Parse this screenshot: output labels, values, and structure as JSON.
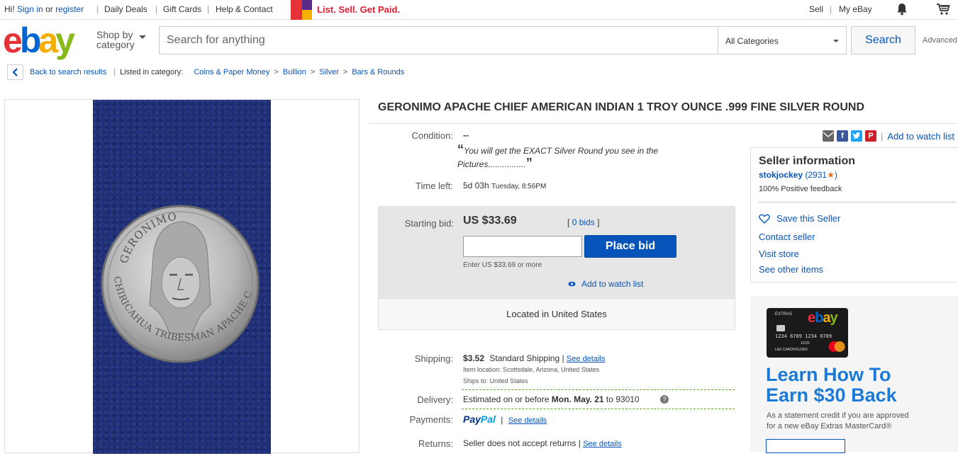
{
  "topbar": {
    "hi": "Hi!",
    "sign_in": "Sign in",
    "or": "or",
    "register": "register",
    "daily_deals": "Daily Deals",
    "gift_cards": "Gift Cards",
    "help": "Help & Contact",
    "promo": "List. Sell. Get Paid.",
    "sell": "Sell",
    "my_ebay": "My eBay"
  },
  "header": {
    "logo": [
      "e",
      "b",
      "a",
      "y"
    ],
    "shop_by": "Shop by",
    "category": "category",
    "search_placeholder": "Search for anything",
    "category_select": "All Categories",
    "search_button": "Search",
    "advanced": "Advanced"
  },
  "breadcrumb": {
    "back": "Back to search results",
    "listed_in": "Listed in category:",
    "items": [
      "Coins & Paper Money",
      "Bullion",
      "Silver",
      "Bars & Rounds"
    ]
  },
  "coin": {
    "top_text": "GERONIMO",
    "bottom_text": "CHIRICAHUA TRIBESMAN APACHE CHIEF"
  },
  "item": {
    "title": "GERONIMO APACHE CHIEF AMERICAN INDIAN 1 TROY OUNCE .999 FINE SILVER ROUND",
    "condition_label": "Condition:",
    "condition_value": "--",
    "quote_line1": "You will get the EXACT Silver Round you see in the",
    "quote_line2": "Pictures................",
    "time_left_label": "Time left:",
    "time_left": "5d 03h",
    "time_left_when": "Tuesday, 8:56PM",
    "share": {
      "watch": "Add to watch list"
    }
  },
  "bid": {
    "label": "Starting bid:",
    "price": "US $33.69",
    "bids_open": "[",
    "bids": "0 bids",
    "bids_close": "]",
    "place_bid": "Place bid",
    "hint": "Enter US $33.69 or more",
    "watch": "Add to watch list",
    "located": "Located in United States"
  },
  "shipping": {
    "label": "Shipping:",
    "price": "$3.52",
    "method": "Standard Shipping |",
    "see_details": "See details",
    "location": "Item location:  Scottsdale, Arizona, United States",
    "ships_to": "Ships to:  United States"
  },
  "delivery": {
    "label": "Delivery:",
    "prefix": "Estimated on or before",
    "date": "Mon. May. 21",
    "to": "to 93010"
  },
  "payments": {
    "label": "Payments:",
    "pay": "Pay",
    "pal": "Pal",
    "sep": "|",
    "see_details": "See details"
  },
  "returns": {
    "label": "Returns:",
    "text": "Seller does not accept returns |",
    "see_details": "See details"
  },
  "seller": {
    "heading": "Seller information",
    "name": "stokjockey",
    "score": "(2931",
    "score_close": ")",
    "feedback": "100% Positive feedback",
    "save": "Save this Seller",
    "contact": "Contact seller",
    "store": "Visit store",
    "other": "See other items"
  },
  "ad": {
    "card_extras": "EXTRAS",
    "card_brand": "ebay",
    "card_number": "1234 6789 1234 6789",
    "card_expiry": "12/20",
    "card_holder": "LEE CARDHOLDER",
    "headline1": "Learn How To",
    "headline2": "Earn $30 Back",
    "sub1": "As a statement credit if you are approved",
    "sub2": "for a new eBay Extras MasterCard®"
  },
  "colors": {
    "link": "#0654ba",
    "primary_button": "#0654ba",
    "promo": "#dd1e31",
    "ad_headline": "#1a7ad6"
  }
}
